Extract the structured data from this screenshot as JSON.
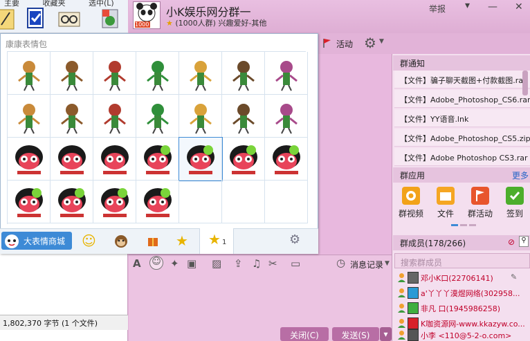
{
  "desktop": {
    "menu_partial": [
      "主要",
      "收藏夹",
      "选中(L)"
    ],
    "status_text": "1,802,370 字节 (1 个文件)"
  },
  "group": {
    "name": "小K娱乐网分群一",
    "members_count_text": "(1000人群)",
    "tagline": "兴趣爱好-其他",
    "avatar_badge": "1000",
    "report_label": "举报"
  },
  "toolbar": {
    "activity_label": "活动"
  },
  "notice": {
    "title": "群通知",
    "files": [
      "【文件】骗子聊天截图+付款截图.rar",
      "【文件】Adobe_Photoshop_CS6.rar",
      "【文件】YY语音.lnk",
      "【文件】Adobe_Photoshop_CS5.zip",
      "【文件】Adobe Photoshop CS3.rar"
    ]
  },
  "apps": {
    "title": "群应用",
    "more": "更多",
    "items": [
      {
        "label": "群视频",
        "icon": "video-icon",
        "color": "#f2a21a"
      },
      {
        "label": "文件",
        "icon": "folder-icon",
        "color": "#f5a623"
      },
      {
        "label": "群活动",
        "icon": "flag-icon",
        "color": "#e8552d"
      },
      {
        "label": "签到",
        "icon": "checkin-icon",
        "color": "#4cae2c"
      }
    ]
  },
  "members": {
    "title": "群成员(178/266)",
    "search_placeholder": "搜索群成员",
    "list": [
      {
        "name": "邓小K口(22706141)",
        "color": "#c0002a"
      },
      {
        "name": "a'丫丫丫漠煜网络(302958...",
        "color": "#c0002a"
      },
      {
        "name": "非凡 口(1945986258)",
        "color": "#c0002a"
      },
      {
        "name": "K咖资源网-www.kkazyw.co...",
        "color": "#c0002a"
      },
      {
        "name": "小李 <110@5-2-o.com>",
        "color": "#c0002a"
      }
    ]
  },
  "chat_input": {
    "history_label": "消息记录"
  },
  "actions": {
    "close_label": "关闭(C)",
    "send_label": "发送(S)"
  },
  "emoji_panel": {
    "title": "康康表情包",
    "mall_label": "大表情商城",
    "tab_badge": "1",
    "rows": 4,
    "cols": 7,
    "filled_cells": 25,
    "selected_cell": 18
  },
  "colors": {
    "window_bg": "#e2b3d8",
    "accent_blue": "#3d8ad6",
    "member_red": "#c0002a"
  }
}
